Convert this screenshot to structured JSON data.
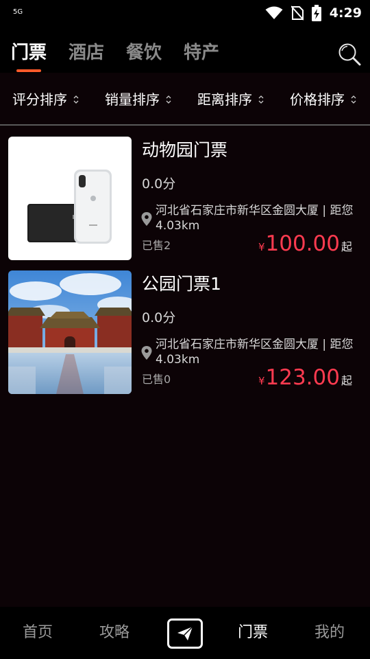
{
  "status_bar": {
    "network": "5G",
    "time": "4:29",
    "icons": [
      "wifi-icon",
      "no-sim-icon",
      "battery-charging-icon"
    ]
  },
  "top_tabs": {
    "items": [
      {
        "label": "门票",
        "active": true
      },
      {
        "label": "酒店",
        "active": false
      },
      {
        "label": "餐饮",
        "active": false
      },
      {
        "label": "特产",
        "active": false
      }
    ],
    "accent_color": "#ff5a2a",
    "search_icon": "search-icon"
  },
  "sort_bar": {
    "items": [
      {
        "label": "评分排序"
      },
      {
        "label": "销量排序"
      },
      {
        "label": "距离排序"
      },
      {
        "label": "价格排序"
      }
    ]
  },
  "listings": [
    {
      "title": "动物园门票",
      "score": "0.0分",
      "address": "河北省石家庄市新华区金圆大厦 | 距您4.03km",
      "sold": "已售2",
      "currency": "¥",
      "price": "100.00",
      "price_suffix": "起",
      "thumbnail": "phone-and-wallet-photo"
    },
    {
      "title": "公园门票1",
      "score": "0.0分",
      "address": "河北省石家庄市新华区金圆大厦 | 距您4.03km",
      "sold": "已售0",
      "currency": "¥",
      "price": "123.00",
      "price_suffix": "起",
      "thumbnail": "palace-photo"
    }
  ],
  "price_color": "#ff3b50",
  "bottom_nav": {
    "items": [
      {
        "label": "首页",
        "active": false
      },
      {
        "label": "攻略",
        "active": false
      },
      {
        "label": "门票",
        "active": true
      },
      {
        "label": "我的",
        "active": false
      }
    ],
    "center_icon": "paper-plane-icon"
  }
}
